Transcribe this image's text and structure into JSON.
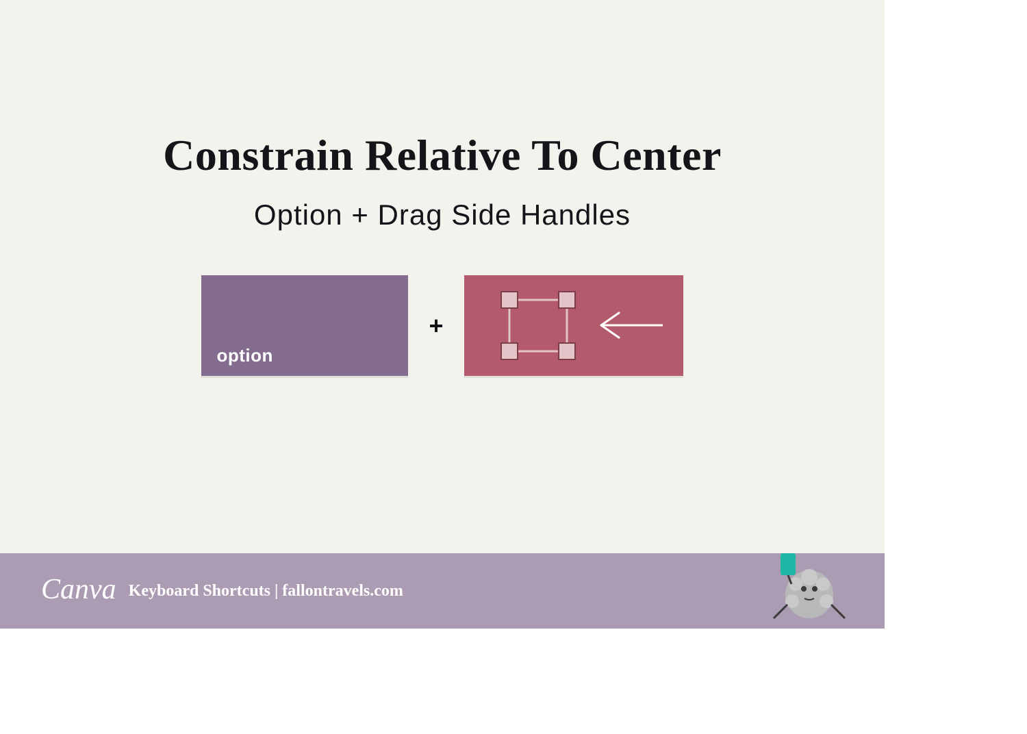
{
  "title": "Constrain Relative To Center",
  "subtitle": "Option + Drag Side Handles",
  "key_label": "option",
  "plus": "+",
  "footer": {
    "logo": "Canva",
    "text": "Keyboard Shortcuts | fallontravels.com"
  },
  "colors": {
    "background": "#f4f2ed",
    "key_block": "#846c8f",
    "drag_block": "#b35b6d",
    "footer": "#ab9bb3",
    "handle_fill": "#e4c3c9",
    "handle_stroke": "#7c3d4b"
  }
}
